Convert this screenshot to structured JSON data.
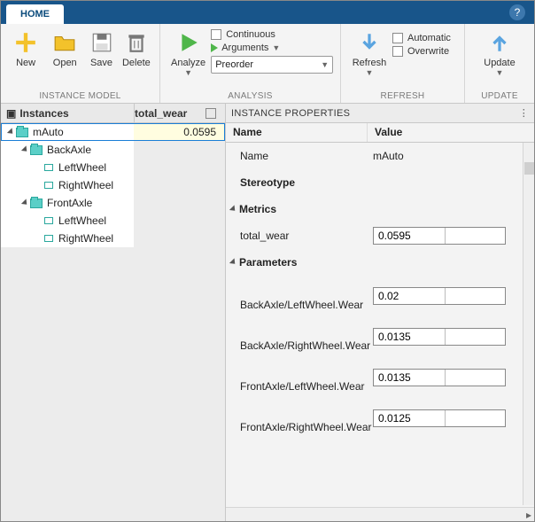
{
  "tabs": {
    "home": "HOME"
  },
  "ribbon": {
    "instance_model": {
      "caption": "INSTANCE MODEL",
      "new": "New",
      "open": "Open",
      "save": "Save",
      "delete": "Delete"
    },
    "analysis": {
      "caption": "ANALYSIS",
      "analyze": "Analyze",
      "continuous": "Continuous",
      "arguments": "Arguments",
      "preorder": "Preorder"
    },
    "refresh": {
      "caption": "REFRESH",
      "refresh": "Refresh",
      "automatic": "Automatic",
      "overwrite": "Overwrite"
    },
    "update": {
      "caption": "UPDATE",
      "update": "Update"
    }
  },
  "tree": {
    "col_instances": "Instances",
    "col_total": "total_wear",
    "rows": [
      {
        "indent": 0,
        "icon": "folder",
        "label": "mAuto",
        "value": "0.0595",
        "selected": true,
        "expandable": true
      },
      {
        "indent": 1,
        "icon": "folder",
        "label": "BackAxle",
        "value": "",
        "expandable": true
      },
      {
        "indent": 2,
        "icon": "port",
        "label": "LeftWheel",
        "value": ""
      },
      {
        "indent": 2,
        "icon": "port",
        "label": "RightWheel",
        "value": ""
      },
      {
        "indent": 1,
        "icon": "folder",
        "label": "FrontAxle",
        "value": "",
        "expandable": true
      },
      {
        "indent": 2,
        "icon": "port",
        "label": "LeftWheel",
        "value": ""
      },
      {
        "indent": 2,
        "icon": "port",
        "label": "RightWheel",
        "value": ""
      }
    ]
  },
  "props": {
    "title": "INSTANCE PROPERTIES",
    "col_name": "Name",
    "col_value": "Value",
    "name_label": "Name",
    "name_value": "mAuto",
    "stereo_label": "Stereotype",
    "metrics_label": "Metrics",
    "metrics": [
      {
        "name": "total_wear",
        "value": "0.0595"
      }
    ],
    "params_label": "Parameters",
    "parameters": [
      {
        "name": "BackAxle/LeftWheel.Wear",
        "value": "0.02"
      },
      {
        "name": "BackAxle/RightWheel.Wear",
        "value": "0.0135"
      },
      {
        "name": "FrontAxle/LeftWheel.Wear",
        "value": "0.0135"
      },
      {
        "name": "FrontAxle/RightWheel.Wear",
        "value": "0.0125"
      }
    ]
  }
}
